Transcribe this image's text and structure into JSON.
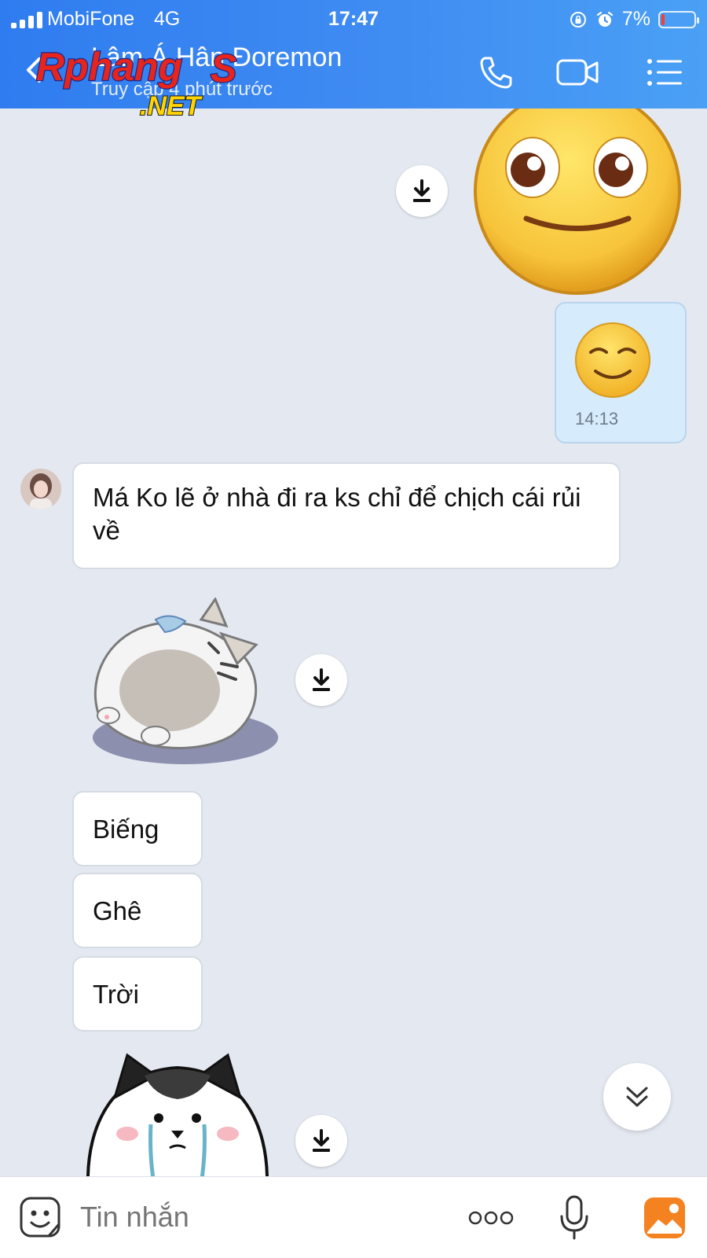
{
  "status_bar": {
    "carrier": "MobiFone",
    "network": "4G",
    "time": "17:47",
    "battery": "7%"
  },
  "header": {
    "title": "Lâm Á Hân Đoremon",
    "subtitle": "Truy cập 4 phút trước",
    "watermark_main": "Rphang",
    "watermark_s": "S",
    "watermark_sub": ".NET"
  },
  "messages": {
    "outgoing_time": "14:13",
    "incoming_text": "Má Ko lẽ ở nhà đi ra ks chỉ để chịch cái rủi về",
    "short": [
      "Biếng",
      "Ghê",
      "Trời"
    ]
  },
  "input": {
    "placeholder": "Tin nhắn"
  },
  "colors": {
    "header": "#3587f1",
    "chat_bg": "#e4e8f0",
    "outgoing_bubble": "#d6ebfb"
  }
}
